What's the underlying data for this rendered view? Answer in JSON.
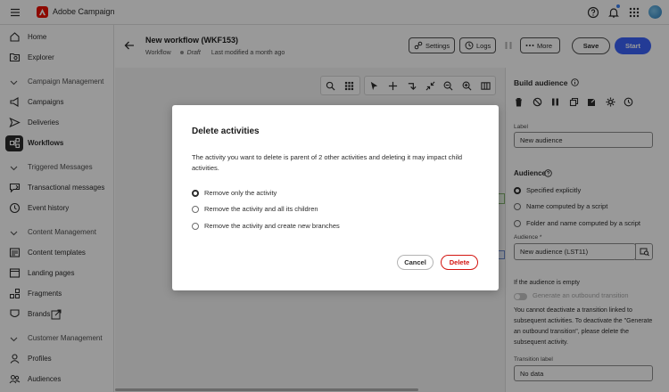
{
  "app": {
    "brand": "Adobe Campaign"
  },
  "sidebar": {
    "items": [
      {
        "label": "Home",
        "icon": "home-icon",
        "section": false
      },
      {
        "label": "Explorer",
        "icon": "explorer-icon",
        "section": false
      },
      {
        "label": "Campaign Management",
        "icon": "chevron-down-icon",
        "section": true
      },
      {
        "label": "Campaigns",
        "icon": "campaigns-icon",
        "section": false
      },
      {
        "label": "Deliveries",
        "icon": "send-icon",
        "section": false
      },
      {
        "label": "Workflows",
        "icon": "workflow-icon",
        "section": false,
        "active": true
      },
      {
        "label": "Triggered Messages",
        "icon": "chevron-down-icon",
        "section": true
      },
      {
        "label": "Transactional messages",
        "icon": "message-icon",
        "section": false
      },
      {
        "label": "Event history",
        "icon": "history-icon",
        "section": false
      },
      {
        "label": "Content Management",
        "icon": "chevron-down-icon",
        "section": true
      },
      {
        "label": "Content templates",
        "icon": "template-icon",
        "section": false
      },
      {
        "label": "Landing pages",
        "icon": "landing-page-icon",
        "section": false
      },
      {
        "label": "Fragments",
        "icon": "fragments-icon",
        "section": false
      },
      {
        "label": "Brands",
        "icon": "brands-icon",
        "section": false
      },
      {
        "label": "Customer Management",
        "icon": "chevron-down-icon",
        "section": true
      },
      {
        "label": "Profiles",
        "icon": "profile-icon",
        "section": false
      },
      {
        "label": "Audiences",
        "icon": "audiences-icon",
        "section": false
      }
    ]
  },
  "header": {
    "title": "New workflow (WKF153)",
    "type": "Workflow",
    "status": "Draft",
    "modified": "Last modified a month ago",
    "settings_label": "Settings",
    "logs_label": "Logs",
    "more_label": "More",
    "save_label": "Save",
    "start_label": "Start"
  },
  "panel": {
    "title": "Build audience",
    "label_caption": "Label",
    "label_value": "New audience",
    "audience_section": "Audience",
    "audience_options": [
      "Specified explicitly",
      "Name computed by a script",
      "Folder and name computed by a script"
    ],
    "audience_selected": 0,
    "audience_field_caption": "Audience",
    "audience_field_required": "*",
    "audience_field_value": "New audience (LST11)",
    "empty_caption": "If the audience is empty",
    "toggle_label": "Generate an outbound transition",
    "info_text": "You cannot deactivate a transition linked to subsequent activities. To deactivate the \"Generate an outbound transition\", please delete the subsequent activity.",
    "transition_caption": "Transition label",
    "transition_value": "No data"
  },
  "modal": {
    "title": "Delete activities",
    "body": "The activity you want to delete is parent of 2 other activities and deleting it may impact child activities.",
    "options": [
      "Remove only the activity",
      "Remove the activity and all its children",
      "Remove the activity and create new branches"
    ],
    "selected": 0,
    "cancel_label": "Cancel",
    "delete_label": "Delete"
  },
  "colors": {
    "accent": "#3b63fb",
    "danger": "#d31510",
    "brand": "#eb1000"
  }
}
